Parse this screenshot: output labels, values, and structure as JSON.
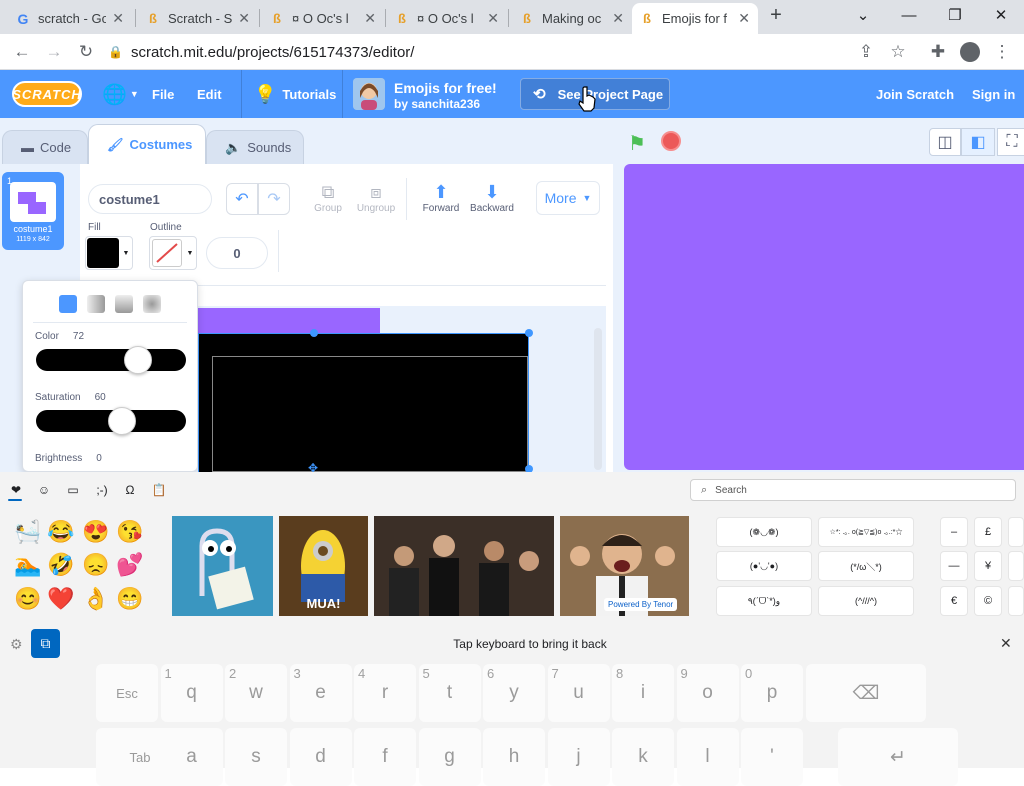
{
  "browser": {
    "tabs": [
      {
        "title": "scratch - Go",
        "icon": "google-icon"
      },
      {
        "title": "Scratch - Se",
        "icon": "scratch-favicon-icon"
      },
      {
        "title": "¤ O Oc's l",
        "icon": "scratch-favicon-icon"
      },
      {
        "title": "¤ O Oc's l",
        "icon": "scratch-favicon-icon"
      },
      {
        "title": "Making oc",
        "icon": "scratch-favicon-icon"
      },
      {
        "title": "Emojis for f",
        "icon": "scratch-favicon-icon"
      }
    ],
    "url": "scratch.mit.edu/projects/615174373/editor/"
  },
  "menubar": {
    "logo": "SCRATCH",
    "file": "File",
    "edit": "Edit",
    "tutorials": "Tutorials",
    "project_title": "Emojis for free!",
    "author": "by sanchita236",
    "see_project": "See Project Page",
    "join": "Join Scratch",
    "signin": "Sign in"
  },
  "editor_tabs": {
    "code": "Code",
    "costumes": "Costumes",
    "sounds": "Sounds"
  },
  "costume": {
    "index": "1",
    "name": "costume1",
    "size": "1119 x 842"
  },
  "paint": {
    "name_value": "costume1",
    "group": "Group",
    "ungroup": "Ungroup",
    "forward": "Forward",
    "backward": "Backward",
    "more": "More",
    "fill_label": "Fill",
    "outline_label": "Outline",
    "outline_width": "0",
    "color_label": "Color",
    "color_value": "72",
    "saturation_label": "Saturation",
    "saturation_value": "60",
    "brightness_label": "Brightness",
    "brightness_value": "0"
  },
  "stage_color": "#9966ff",
  "keyboard": {
    "search_placeholder": "Search",
    "emojis": [
      "🛀",
      "😂",
      "😍",
      "😘",
      "🏊",
      "🤣",
      "😞",
      "💕",
      "😊",
      "❤️",
      "👌",
      "😁"
    ],
    "gif_mua": "MUA!",
    "tenor": "Powered By Tenor",
    "kaomoji": [
      "(❁◡❁)",
      "☆*: .｡. o(≧▽≦)o .｡.:*☆",
      "(●'◡'●)",
      "(*/ω＼*)",
      "٩(ˊᗜˋ*)و",
      "(^///^)"
    ],
    "symbols": [
      "–",
      "£",
      "—",
      "¥",
      "€",
      "©"
    ],
    "tap_msg": "Tap keyboard to bring it back",
    "row1": [
      {
        "k": "Esc",
        "h": ""
      },
      {
        "k": "q",
        "h": "1"
      },
      {
        "k": "w",
        "h": "2"
      },
      {
        "k": "e",
        "h": "3"
      },
      {
        "k": "r",
        "h": "4"
      },
      {
        "k": "t",
        "h": "5"
      },
      {
        "k": "y",
        "h": "6"
      },
      {
        "k": "u",
        "h": "7"
      },
      {
        "k": "i",
        "h": "8"
      },
      {
        "k": "o",
        "h": "9"
      },
      {
        "k": "p",
        "h": "0"
      }
    ],
    "row2": [
      {
        "k": "Tab",
        "h": ""
      },
      {
        "k": "a",
        "h": ""
      },
      {
        "k": "s",
        "h": ""
      },
      {
        "k": "d",
        "h": ""
      },
      {
        "k": "f",
        "h": ""
      },
      {
        "k": "g",
        "h": ""
      },
      {
        "k": "h",
        "h": ""
      },
      {
        "k": "j",
        "h": ""
      },
      {
        "k": "k",
        "h": ""
      },
      {
        "k": "l",
        "h": ""
      },
      {
        "k": "'",
        "h": ""
      }
    ]
  }
}
